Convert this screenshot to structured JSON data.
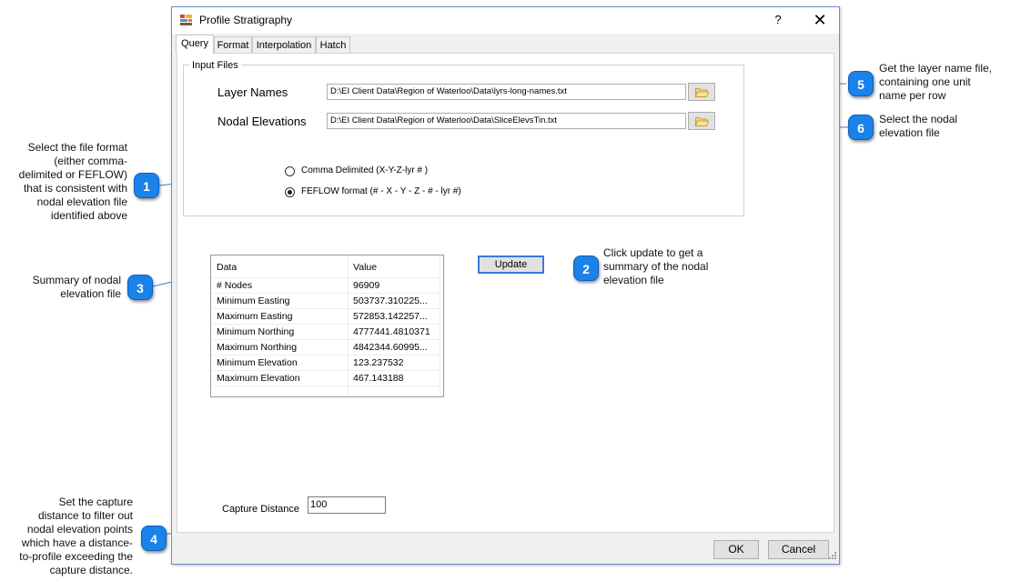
{
  "window": {
    "title": "Profile Stratigraphy",
    "help_glyph": "?",
    "close_glyph": "✕"
  },
  "tabs": [
    "Query",
    "Format",
    "Interpolation",
    "Hatch"
  ],
  "input_files": {
    "legend": "Input Files",
    "layer_names_label": "Layer Names",
    "layer_names_path": "D:\\EI Client Data\\Region of Waterloo\\Data\\lyrs-long-names.txt",
    "nodal_elev_label": "Nodal Elevations",
    "nodal_elev_path": "D:\\EI Client Data\\Region of Waterloo\\Data\\SliceElevsTin.txt"
  },
  "format": {
    "options": [
      "Comma Delimited (X-Y-Z-lyr # )",
      "FEFLOW format (# - X - Y - Z - # - lyr #)"
    ],
    "selected": "FEFLOW format (# - X - Y - Z - # - lyr #)"
  },
  "summary": {
    "headers": [
      "Data",
      "Value"
    ],
    "rows": [
      [
        "# Nodes",
        "96909"
      ],
      [
        "Minimum Easting",
        "503737.310225..."
      ],
      [
        "Maximum Easting",
        "572853.142257..."
      ],
      [
        "Minimum Northing",
        "4777441.4810371"
      ],
      [
        "Maximum Northing",
        "4842344.60995..."
      ],
      [
        "Minimum Elevation",
        "123.237532"
      ],
      [
        "Maximum Elevation",
        "467.143188"
      ]
    ]
  },
  "update_label": "Update",
  "capture": {
    "label": "Capture Distance",
    "value": "100"
  },
  "buttons": {
    "ok": "OK",
    "cancel": "Cancel"
  },
  "callouts": [
    {
      "number": "1",
      "lines": [
        "Select the file format",
        "(either comma-",
        "delimited or FEFLOW)",
        "that is consistent with",
        "nodal elevation file",
        "identified above"
      ]
    },
    {
      "number": "2",
      "lines": [
        "Click update to get a",
        "summary of the nodal",
        "elevation file"
      ]
    },
    {
      "number": "3",
      "lines": [
        "Summary of nodal",
        "elevation file"
      ]
    },
    {
      "number": "4",
      "lines": [
        "Set the capture",
        "distance to filter out",
        "nodal elevation points",
        "which have a distance-",
        "to-profile exceeding the",
        "capture distance."
      ]
    },
    {
      "number": "5",
      "lines": [
        "Get the layer name file,",
        "containing one unit",
        "name per row"
      ]
    },
    {
      "number": "6",
      "lines": [
        "Select the nodal",
        "elevation file"
      ]
    }
  ],
  "colors": {
    "callout_badge": "#1a82e8",
    "window_border": "#6a8ed4",
    "leader_line": "#3b7bd8"
  },
  "icons": {
    "app": "app-icon",
    "browse": "folder-open-icon",
    "close": "close-icon",
    "help": "help-icon"
  }
}
